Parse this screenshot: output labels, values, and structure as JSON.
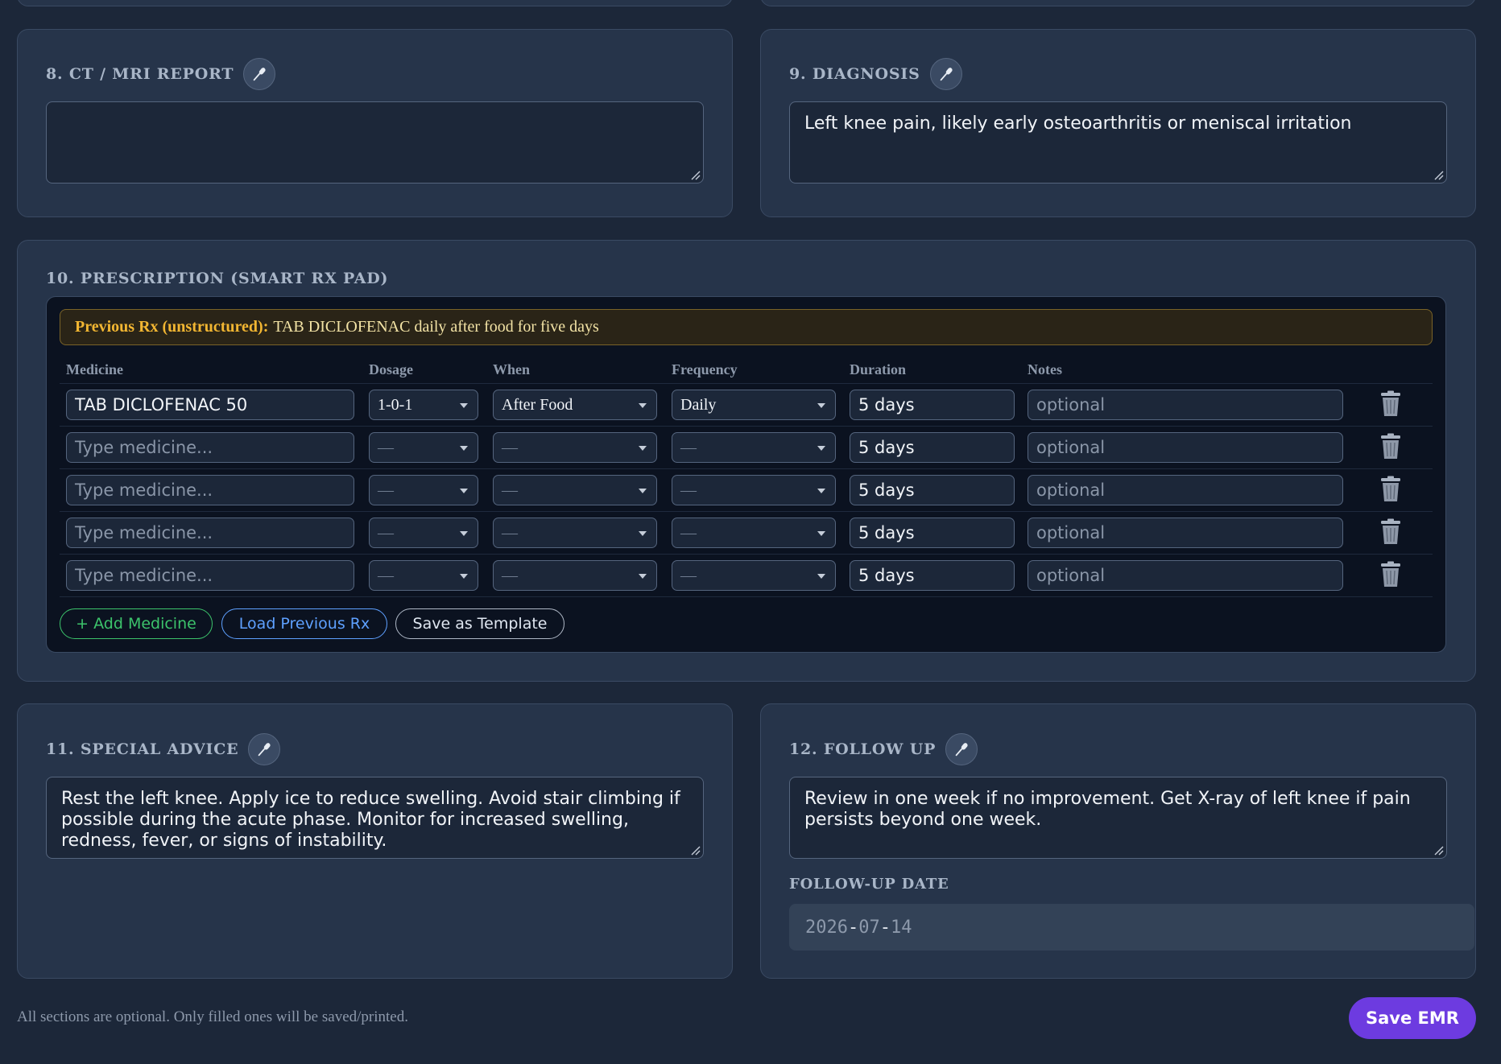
{
  "sections": {
    "ct_mri": {
      "title": "8. CT / MRI REPORT",
      "value": ""
    },
    "diagnosis": {
      "title": "9. DIAGNOSIS",
      "value": "Left knee pain, likely early osteoarthritis or meniscal irritation"
    },
    "prescription": {
      "title": "10. PRESCRIPTION (SMART RX PAD)",
      "previous_rx_label": "Previous Rx (unstructured):",
      "previous_rx_text": "TAB DICLOFENAC daily after food for five days",
      "columns": [
        "Medicine",
        "Dosage",
        "When",
        "Frequency",
        "Duration",
        "Notes"
      ],
      "medicine_placeholder": "Type medicine...",
      "notes_placeholder": "optional",
      "rows": [
        {
          "medicine": "TAB DICLOFENAC 50",
          "dosage": "1-0-1",
          "when": "After Food",
          "frequency": "Daily",
          "duration": "5 days",
          "notes": ""
        },
        {
          "medicine": "",
          "dosage": "—",
          "when": "—",
          "frequency": "—",
          "duration": "5 days",
          "notes": ""
        },
        {
          "medicine": "",
          "dosage": "—",
          "when": "—",
          "frequency": "—",
          "duration": "5 days",
          "notes": ""
        },
        {
          "medicine": "",
          "dosage": "—",
          "when": "—",
          "frequency": "—",
          "duration": "5 days",
          "notes": ""
        },
        {
          "medicine": "",
          "dosage": "—",
          "when": "—",
          "frequency": "—",
          "duration": "5 days",
          "notes": ""
        }
      ],
      "buttons": {
        "add": "+ Add Medicine",
        "load": "Load Previous Rx",
        "template": "Save as Template"
      }
    },
    "special_advice": {
      "title": "11. SPECIAL ADVICE",
      "value": "Rest the left knee. Apply ice to reduce swelling. Avoid stair climbing if possible during the acute phase. Monitor for increased swelling, redness, fever, or signs of instability."
    },
    "follow_up": {
      "title": "12. FOLLOW UP",
      "value": "Review in one week if no improvement. Get X-ray of left knee if pain persists beyond one week.",
      "date_label": "FOLLOW-UP DATE",
      "date_year": "2026",
      "date_month": "07",
      "date_day": "14"
    }
  },
  "footer": {
    "note": "All sections are optional. Only filled ones will be saved/printed.",
    "save_label": "Save EMR"
  },
  "colors": {
    "accent": "#6d3be0",
    "add": "#3cc36b",
    "load": "#5ea0ff",
    "warning": "#f2b632"
  }
}
